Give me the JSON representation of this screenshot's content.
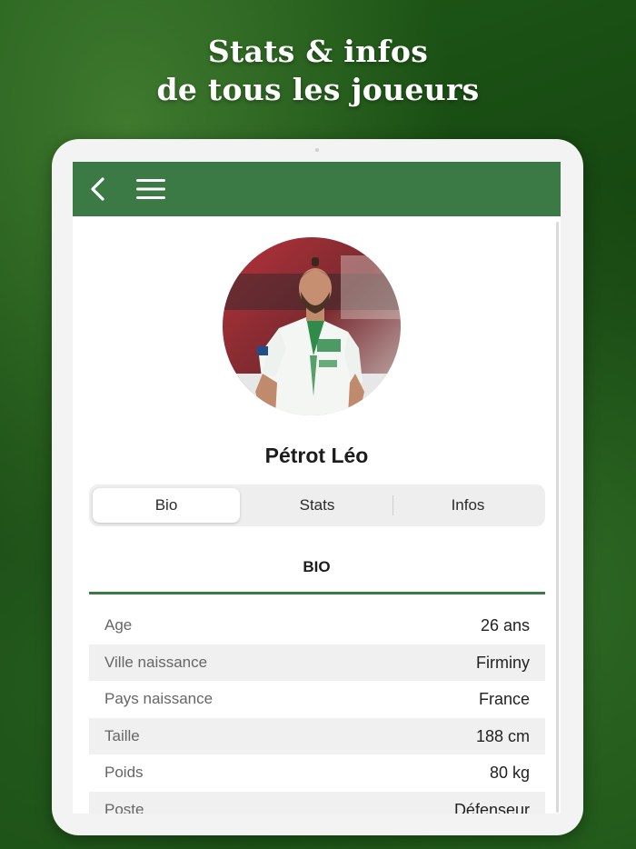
{
  "headline": {
    "line1": "Stats & infos",
    "line2": "de tous les joueurs"
  },
  "colors": {
    "brand_green": "#3c7a45",
    "background_green": "#1b5215"
  },
  "appbar": {
    "back_icon": "chevron-left-icon",
    "menu_icon": "hamburger-menu-icon"
  },
  "player": {
    "name": "Pétrot Léo"
  },
  "tabs": [
    {
      "label": "Bio",
      "active": true
    },
    {
      "label": "Stats",
      "active": false
    },
    {
      "label": "Infos",
      "active": false
    }
  ],
  "section": {
    "title": "BIO"
  },
  "bio": [
    {
      "label": "Age",
      "value": "26 ans"
    },
    {
      "label": "Ville naissance",
      "value": "Firminy"
    },
    {
      "label": "Pays naissance",
      "value": "France"
    },
    {
      "label": "Taille",
      "value": "188 cm"
    },
    {
      "label": "Poids",
      "value": "80 kg"
    },
    {
      "label": "Poste",
      "value": "Défenseur"
    }
  ]
}
